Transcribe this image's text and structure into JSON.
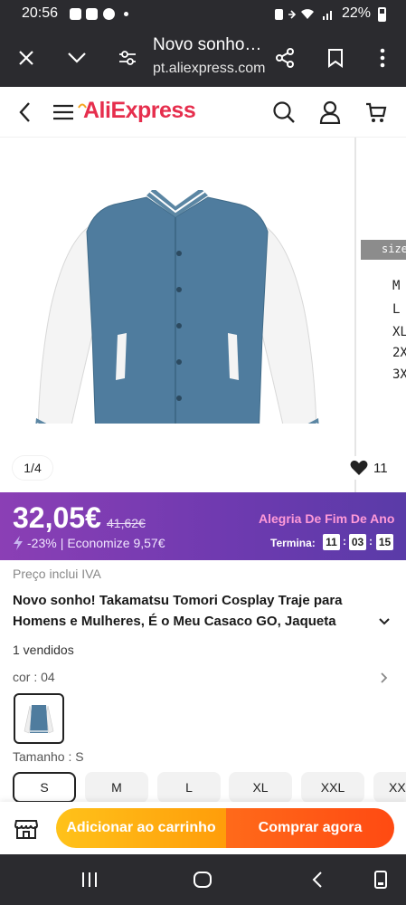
{
  "status_bar": {
    "time": "20:56",
    "battery": "22%"
  },
  "browser": {
    "title": "Novo sonho…",
    "url": "pt.aliexpress.com"
  },
  "site": {
    "logo": "AliExpress"
  },
  "gallery": {
    "counter": "1/4",
    "wishlist_count": "11",
    "size_chart_label": "size",
    "size_chart_items": [
      "M",
      "L",
      "XL",
      "2X",
      "3X"
    ]
  },
  "promo": {
    "price": "32,05€",
    "original_price": "41,62€",
    "discount": "-23%",
    "savings": "Economize 9,57€",
    "promo_name": "Alegria De Fim De Ano",
    "ends_label": "Termina:",
    "timer": [
      "11",
      "03",
      "15"
    ],
    "colors": {
      "start": "#8b3fb5",
      "end": "#5a3ba8",
      "promo_name": "#ff9ad8"
    }
  },
  "product": {
    "vat_note": "Preço inclui IVA",
    "title": "Novo sonho! Takamatsu Tomori Cosplay Traje para Homens e Mulheres, É o Meu Casaco GO, Jaqueta",
    "sold": "1 vendidos",
    "color_label": "cor : 04",
    "size_label": "Tamanho : S",
    "sizes": [
      "S",
      "M",
      "L",
      "XL",
      "XXL",
      "XXXL"
    ],
    "selected_size": "S"
  },
  "actions": {
    "add_to_cart": "Adicionar ao carrinho",
    "buy_now": "Comprar agora",
    "colors": {
      "add_to_cart": "#ffb015",
      "buy_now": "#ff5a14"
    }
  },
  "icons": {
    "browser": [
      "close-icon",
      "chevron-down-icon",
      "tune-icon",
      "share-icon",
      "bookmark-icon",
      "more-vert-icon"
    ],
    "site": [
      "back-icon",
      "menu-icon",
      "search-icon",
      "account-icon",
      "cart-icon"
    ],
    "nav": [
      "recents-icon",
      "home-icon",
      "back-icon",
      "screenshot-icon"
    ]
  }
}
